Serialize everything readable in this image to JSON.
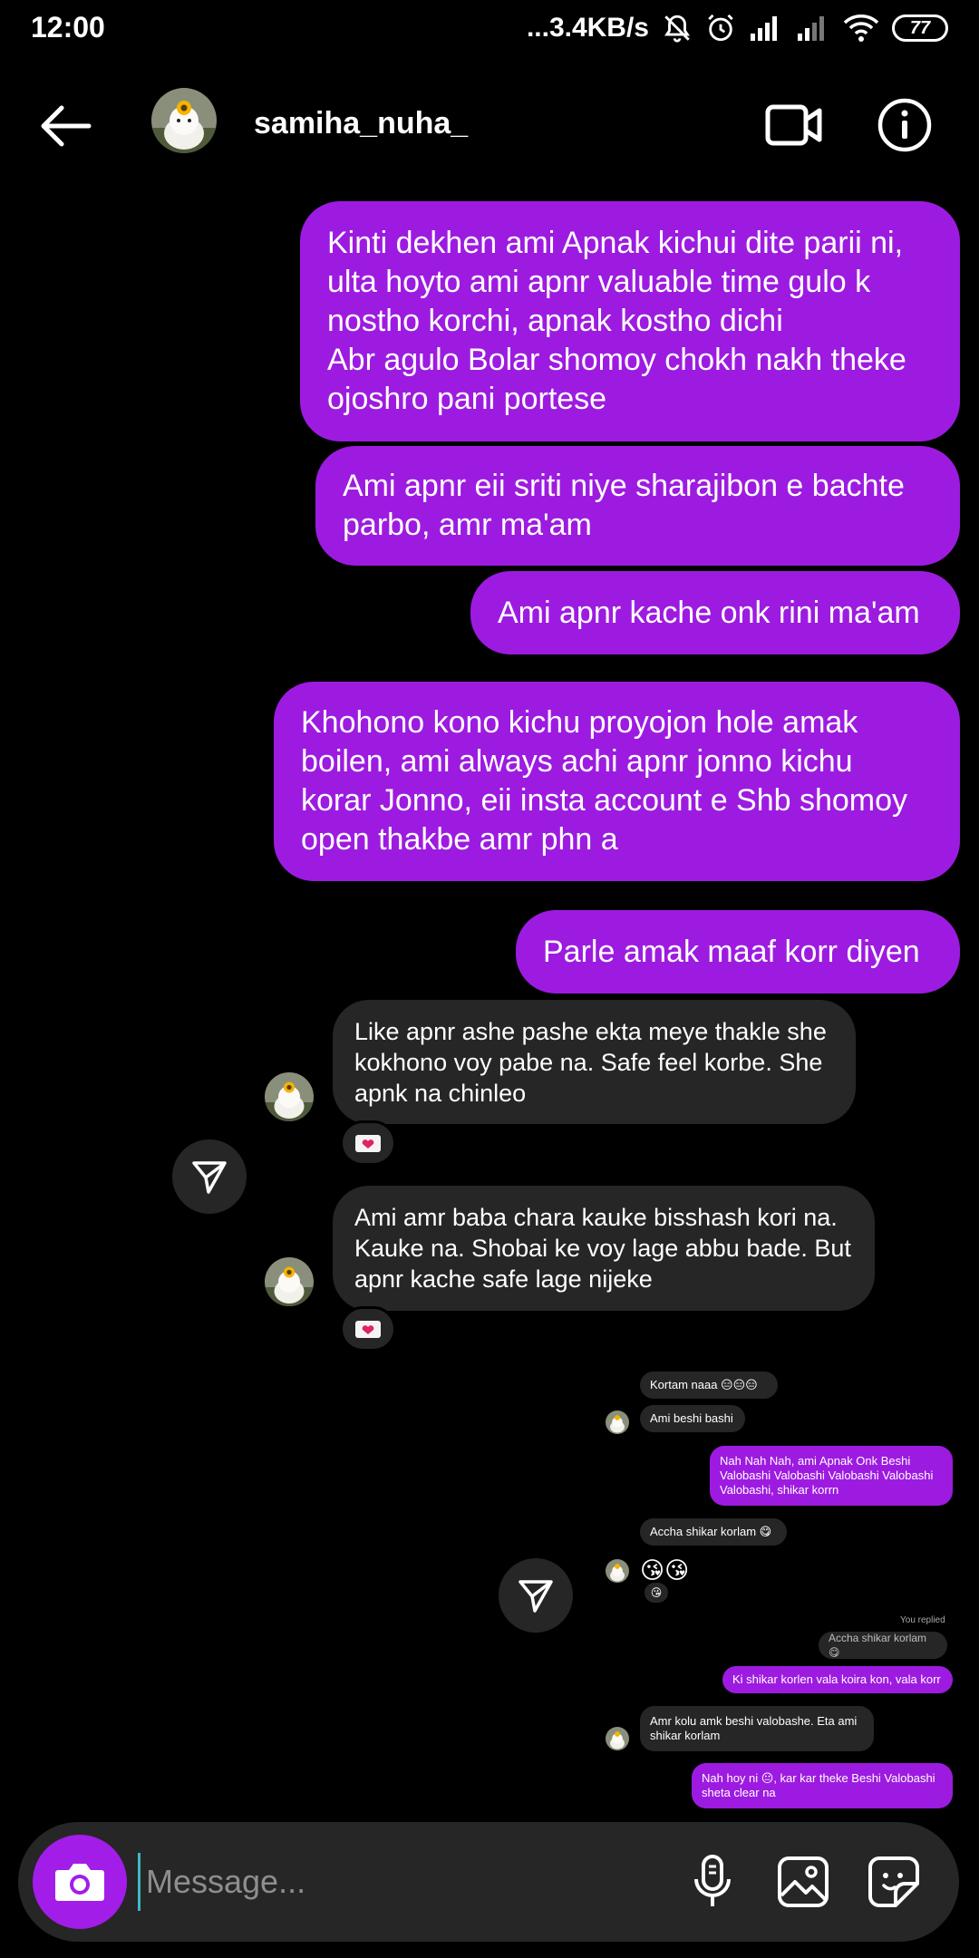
{
  "status_bar": {
    "time": "12:00",
    "speed": "...3.4KB/s",
    "battery": "77",
    "icons": [
      "bell-off-icon",
      "alarm-icon",
      "signal-icon",
      "signal-icon",
      "wifi-icon",
      "battery-icon"
    ]
  },
  "header": {
    "username": "samiha_nuha_",
    "back_icon": "arrow-left-icon",
    "video_icon": "video-camera-icon",
    "info_icon": "info-icon"
  },
  "messages": [
    {
      "type": "sent",
      "text": "Kinti dekhen ami Apnak kichui dite parii ni,\nulta hoyto ami apnr valuable time gulo k\nnostho korchi, apnak kostho dichi\nAbr agulo Bolar shomoy chokh nakh theke\nojoshro pani portese"
    },
    {
      "type": "sent",
      "text": "Ami apnr eii sriti niye sharajibon e bachte\nparbo, amr ma'am"
    },
    {
      "type": "sent",
      "text": "Ami apnr kache onk rini ma'am"
    },
    {
      "type": "sent",
      "text": "Khohono kono kichu proyojon hole amak\nboilen, ami always achi apnr jonno kichu\nkorar Jonno, eii insta account e Shb shomoy\nopen thakbe amr phn a"
    },
    {
      "type": "sent",
      "text": "Parle amak maaf korr diyen"
    },
    {
      "type": "received",
      "text": "Like apnr ashe pashe ekta meye thakle she\nkokhono voy pabe na. Safe feel korbe. She\napnk na chinleo",
      "reaction": "❤️"
    },
    {
      "type": "received",
      "text": "Ami amr baba chara kauke bisshash kori na.\nKauke na. Shobai ke voy lage abbu bade. But\napnr kache safe lage nijeke",
      "reaction": "❤️"
    }
  ],
  "mini_chat": [
    {
      "type": "received",
      "text": "Kortam naaa 😑😑😑"
    },
    {
      "type": "received",
      "text": "Ami beshi bashi"
    },
    {
      "type": "sent",
      "text": "Nah Nah Nah, ami Apnak Onk Beshi\nValobashi Valobashi Valobashi Valobashi\nValobashi, shikar korrn"
    },
    {
      "type": "received",
      "text": "Accha shikar korlam 😋"
    },
    {
      "type": "received",
      "text": "😘😘",
      "reaction": "😘"
    },
    {
      "type": "note",
      "text": "You replied"
    },
    {
      "type": "received",
      "text": "Accha shikar korlam 😋"
    },
    {
      "type": "sent",
      "text": "Ki shikar korlen vala koira kon, vala korr"
    },
    {
      "type": "received",
      "text": "Amr kolu amk beshi valobashe. Eta ami\nshikar korlam"
    },
    {
      "type": "sent",
      "text": "Nah hoy ni 😐, kar kar theke Beshi Valobashi\nsheta clear na"
    }
  ],
  "composer": {
    "placeholder": "Message...",
    "camera_icon": "camera-icon",
    "mic_icon": "microphone-icon",
    "gallery_icon": "image-icon",
    "sticker_icon": "sticker-icon"
  },
  "colors": {
    "sent_bubble": "#9d1be0",
    "received_bubble": "#262626",
    "background": "#000000",
    "camera_button": "#a21de8"
  }
}
